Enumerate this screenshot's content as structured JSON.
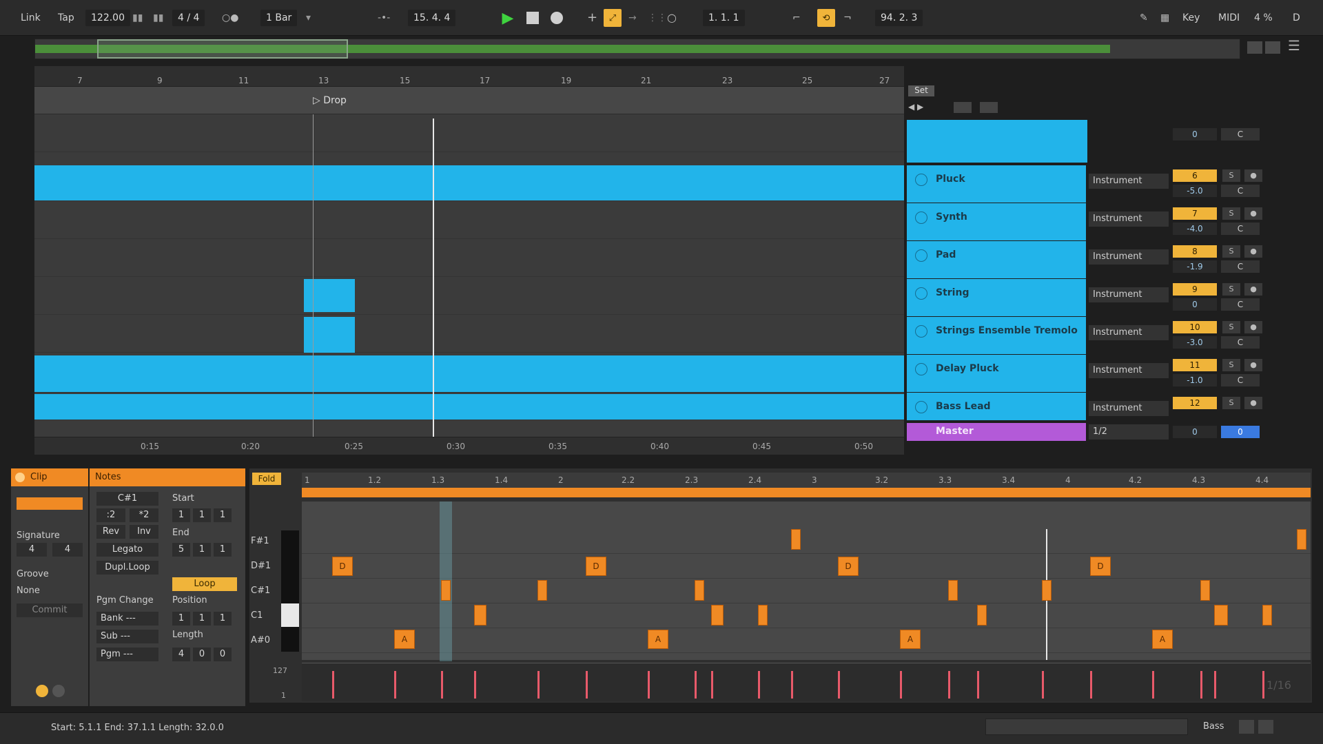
{
  "transport": {
    "link": "Link",
    "tap": "Tap",
    "tempo": "122.00",
    "signature": "4 / 4",
    "quantize": "1 Bar",
    "position": "15.  4.  4",
    "loop_start": "1.  1.  1",
    "loop_length": "94.  2.  3",
    "key": "Key",
    "midi": "MIDI",
    "cpu": "4 %",
    "disk": "D"
  },
  "ruler": [
    "7",
    "9",
    "11",
    "13",
    "15",
    "17",
    "19",
    "21",
    "23",
    "25",
    "27"
  ],
  "locator": "Drop",
  "timeline": [
    "0:15",
    "0:20",
    "0:25",
    "0:30",
    "0:35",
    "0:40",
    "0:45",
    "0:50"
  ],
  "set_label": "Set",
  "tracks": [
    {
      "name": "Pluck",
      "device": "Instrument",
      "num": "6",
      "vol": "-5.0",
      "pan": "C"
    },
    {
      "name": "Synth",
      "device": "Instrument",
      "num": "7",
      "vol": "-4.0",
      "pan": "C"
    },
    {
      "name": "Pad",
      "device": "Instrument",
      "num": "8",
      "vol": "-1.9",
      "pan": "C"
    },
    {
      "name": "String",
      "device": "Instrument",
      "num": "9",
      "vol": "0",
      "pan": "C"
    },
    {
      "name": "Strings Ensemble Tremolo",
      "device": "Instrument",
      "num": "10",
      "vol": "-3.0",
      "pan": "C"
    },
    {
      "name": "Delay Pluck",
      "device": "Instrument",
      "num": "11",
      "vol": "-1.0",
      "pan": "C"
    },
    {
      "name": "Bass Lead",
      "device": "Instrument",
      "num": "12",
      "vol": "",
      "pan": ""
    }
  ],
  "top_row": {
    "vol": "0",
    "pan": "C"
  },
  "master": {
    "name": "Master",
    "routing": "1/2",
    "vol": "0",
    "send": "0"
  },
  "solo_label": "S",
  "clip_panel": {
    "title": "Clip",
    "signature_label": "Signature",
    "sig_num": "4",
    "sig_den": "4",
    "groove_label": "Groove",
    "groove_value": "None",
    "commit": "Commit"
  },
  "notes_panel": {
    "title": "Notes",
    "key": "C#1",
    "div2": ":2",
    "mul2": "*2",
    "rev": "Rev",
    "inv": "Inv",
    "legato": "Legato",
    "dupl": "Dupl.Loop",
    "start_label": "Start",
    "start": [
      "1",
      "1",
      "1"
    ],
    "end_label": "End",
    "end": [
      "5",
      "1",
      "1"
    ],
    "loop": "Loop",
    "pgm_change": "Pgm Change",
    "position_label": "Position",
    "position": [
      "1",
      "1",
      "1"
    ],
    "bank": "Bank ---",
    "sub": "Sub ---",
    "pgm": "Pgm ---",
    "length_label": "Length",
    "length": [
      "4",
      "0",
      "0"
    ]
  },
  "piano": {
    "fold": "Fold",
    "ruler": [
      "1",
      "1.2",
      "1.3",
      "1.4",
      "2",
      "2.2",
      "2.3",
      "2.4",
      "3",
      "3.2",
      "3.3",
      "3.4",
      "4",
      "4.2",
      "4.3",
      "4.4"
    ],
    "keys": [
      "F#1",
      "D#1",
      "C#1",
      "C1",
      "A#0"
    ],
    "vel_max": "127",
    "vel_min": "1",
    "grid": "1/16"
  },
  "status": {
    "selection": "Start: 5.1.1  End: 37.1.1  Length: 32.0.0",
    "track": "Bass"
  },
  "colors": {
    "clip": "#22b4ea",
    "note": "#f08a24",
    "master": "#b35ad8"
  }
}
